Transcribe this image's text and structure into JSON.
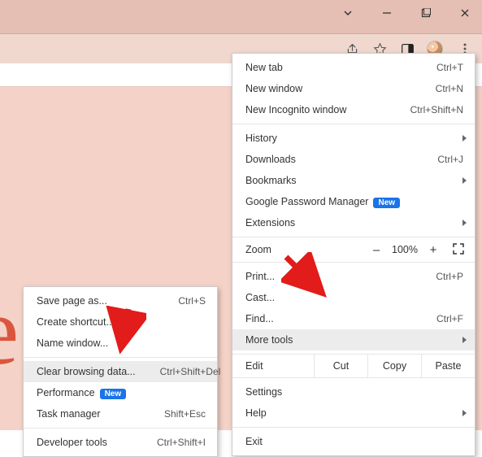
{
  "window_controls": {
    "dropdown": "⌄",
    "minimize": "–",
    "maximize": "▢",
    "close": "✕"
  },
  "toolbar_icons": {
    "share": "share-icon",
    "bookmark_star": "star-icon",
    "side_panel": "side-panel-icon",
    "profile": "profile-avatar",
    "menu": "menu-icon"
  },
  "content_sample_letter": "e",
  "main_menu": {
    "new_tab": "New tab",
    "new_tab_sc": "Ctrl+T",
    "new_window": "New window",
    "new_window_sc": "Ctrl+N",
    "new_incognito": "New Incognito window",
    "new_incognito_sc": "Ctrl+Shift+N",
    "history": "History",
    "downloads": "Downloads",
    "downloads_sc": "Ctrl+J",
    "bookmarks": "Bookmarks",
    "passwords": "Google Password Manager",
    "passwords_badge": "New",
    "extensions": "Extensions",
    "zoom_label": "Zoom",
    "zoom_minus": "–",
    "zoom_value": "100%",
    "zoom_plus": "+",
    "print": "Print...",
    "print_sc": "Ctrl+P",
    "cast": "Cast...",
    "find": "Find...",
    "find_sc": "Ctrl+F",
    "more_tools": "More tools",
    "edit_label": "Edit",
    "edit_cut": "Cut",
    "edit_copy": "Copy",
    "edit_paste": "Paste",
    "settings": "Settings",
    "help": "Help",
    "exit": "Exit"
  },
  "sub_menu": {
    "save_page": "Save page as...",
    "save_page_sc": "Ctrl+S",
    "create_shortcut": "Create shortcut...",
    "name_window": "Name window...",
    "clear_browsing": "Clear browsing data...",
    "clear_browsing_sc": "Ctrl+Shift+Del",
    "performance": "Performance",
    "performance_badge": "New",
    "task_manager": "Task manager",
    "task_manager_sc": "Shift+Esc",
    "developer_tools": "Developer tools",
    "developer_tools_sc": "Ctrl+Shift+I"
  }
}
